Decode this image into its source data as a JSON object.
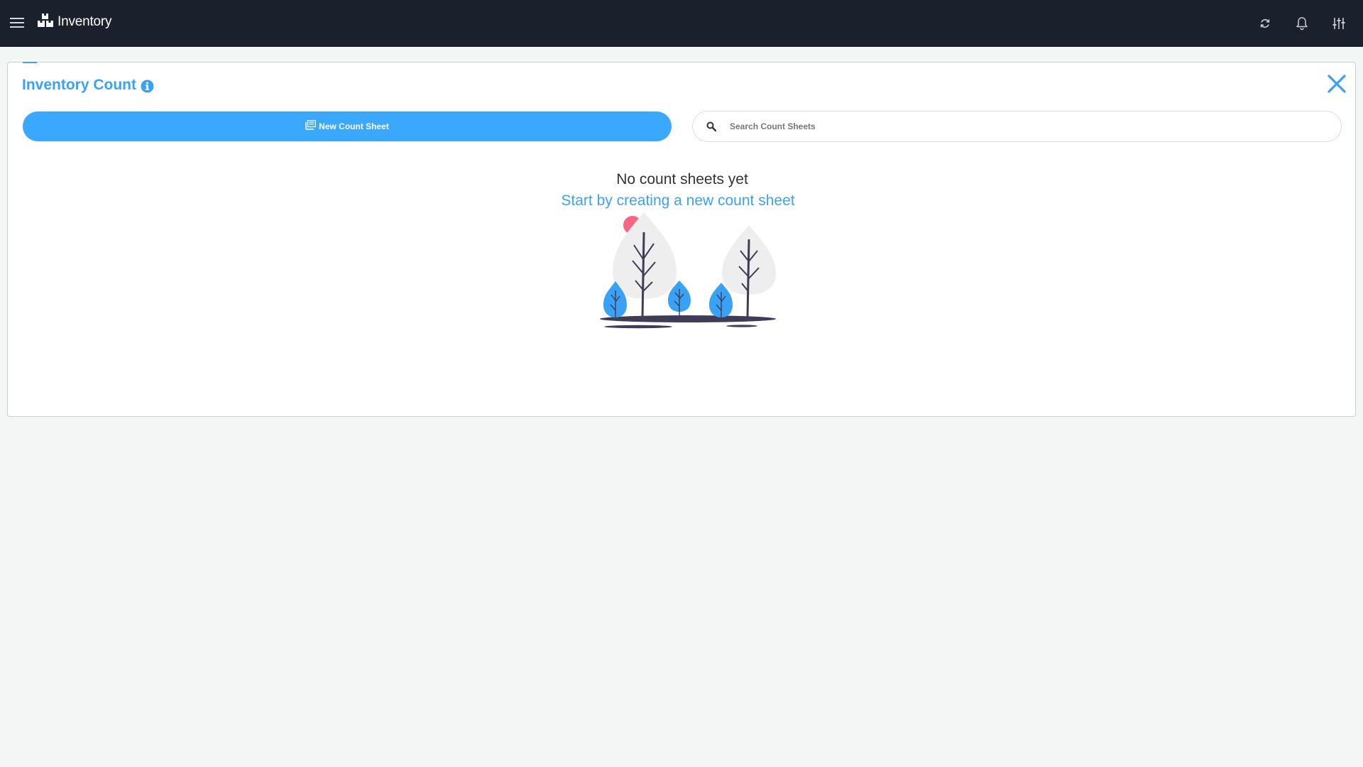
{
  "app": {
    "title": "Inventory",
    "icons": {
      "menu": "hamburger-menu-icon",
      "logo": "boxes-logo-icon",
      "refresh": "refresh-icon",
      "notifications": "bell-icon",
      "settings": "sliders-icon"
    }
  },
  "panel": {
    "title": "Inventory Count",
    "new_button_label": "New Count Sheet",
    "search": {
      "placeholder": "Search Count Sheets",
      "value": ""
    },
    "empty_state": {
      "heading": "No count sheets yet",
      "subheading": "Start by creating a new count sheet"
    }
  },
  "colors": {
    "topbar": "#1a202c",
    "accent": "#3aa2f5",
    "button": "#3aa8ff",
    "illustration_accent": "#f7677f",
    "illustration_dark": "#3f3d56"
  }
}
